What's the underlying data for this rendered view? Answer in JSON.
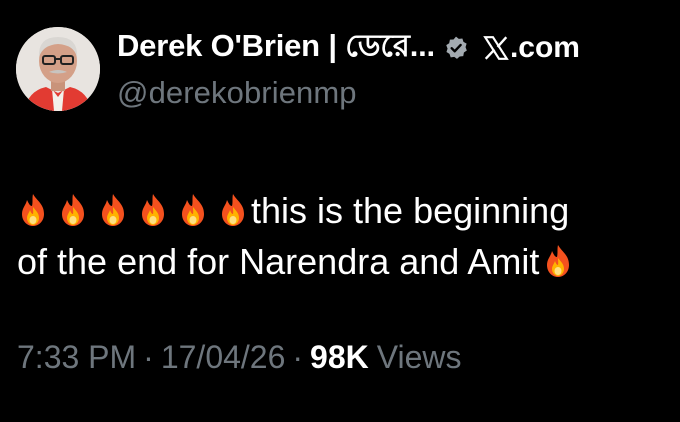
{
  "author": {
    "display_name": "Derek O'Brien | ডেরে...",
    "handle": "@derekobrienmp",
    "verified": true,
    "avatar_icon": "profile-photo",
    "verified_icon": "verified-badge-icon",
    "verified_color": "#a3aab0"
  },
  "source": {
    "logo_icon": "x-logo-icon",
    "label": ".com"
  },
  "tweet": {
    "line1_text": "this is the beginning",
    "line2_text": "of the end for Narendra and Amit",
    "emoji": "fire-emoji",
    "emoji_count_line1": 6,
    "emoji_count_line2": 1
  },
  "meta": {
    "time": "7:33 PM",
    "separator": "·",
    "date": "17/04/26",
    "views_count": "98K",
    "views_label": "Views"
  },
  "colors": {
    "background": "#000000",
    "text": "#ffffff",
    "secondary_text": "#6e767d"
  }
}
